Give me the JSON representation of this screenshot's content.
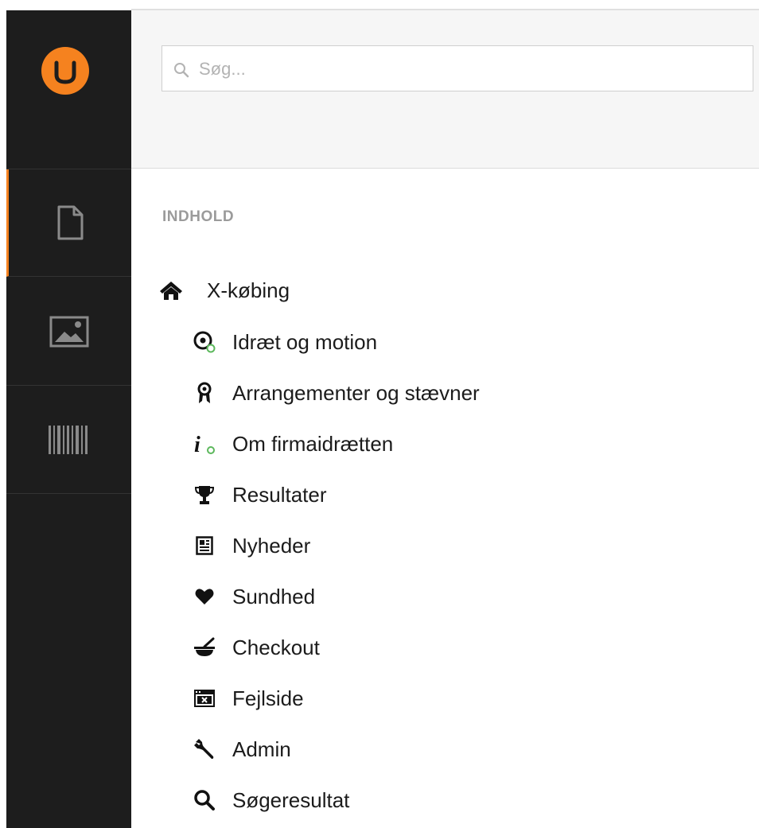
{
  "brand": {
    "accent_color": "#f5821f",
    "sidebar_bg": "#1d1d1d"
  },
  "sidebar": {
    "items": [
      {
        "icon": "document-icon",
        "active": true
      },
      {
        "icon": "image-icon",
        "active": false
      },
      {
        "icon": "barcode-icon",
        "active": false
      }
    ]
  },
  "search": {
    "placeholder": "Søg..."
  },
  "tree": {
    "section_title": "INDHOLD",
    "root": {
      "label": "X-købing",
      "icon": "home-icon"
    },
    "items": [
      {
        "label": "Idræt og motion",
        "icon": "target-icon"
      },
      {
        "label": "Arrangementer og stævner",
        "icon": "award-icon"
      },
      {
        "label": "Om firmaidrætten",
        "icon": "info-icon"
      },
      {
        "label": "Resultater",
        "icon": "trophy-icon"
      },
      {
        "label": "Nyheder",
        "icon": "newspaper-icon"
      },
      {
        "label": "Sundhed",
        "icon": "heart-icon"
      },
      {
        "label": "Checkout",
        "icon": "mortar-icon"
      },
      {
        "label": "Fejlside",
        "icon": "error-window-icon"
      },
      {
        "label": "Admin",
        "icon": "wrench-icon"
      },
      {
        "label": "Søgeresultat",
        "icon": "search-icon"
      }
    ]
  }
}
